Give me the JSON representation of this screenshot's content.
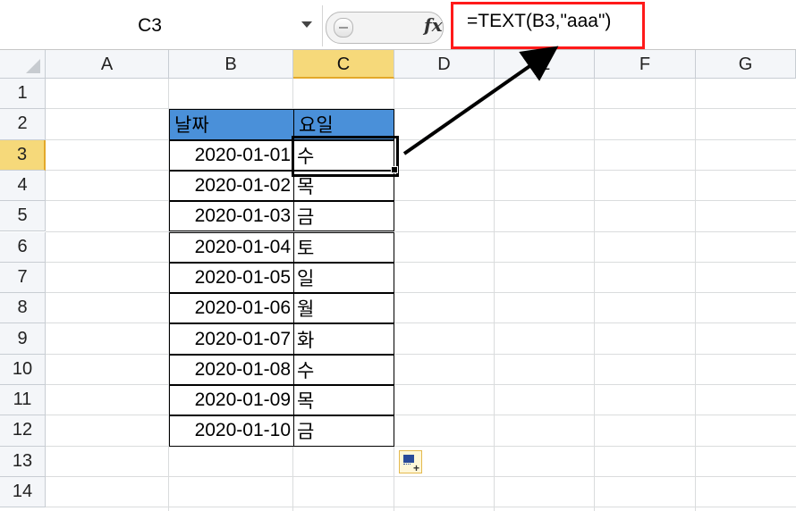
{
  "formula_bar": {
    "name_box": "C3",
    "fx_label": "fx",
    "formula": "=TEXT(B3,\"aaa\")"
  },
  "columns": [
    "A",
    "B",
    "C",
    "D",
    "E",
    "F",
    "G"
  ],
  "rows": [
    "1",
    "2",
    "3",
    "4",
    "5",
    "6",
    "7",
    "8",
    "9",
    "10",
    "11",
    "12",
    "13",
    "14"
  ],
  "selected": {
    "column": "C",
    "row": "3"
  },
  "table": {
    "headers": [
      "날짜",
      "요일"
    ],
    "data": [
      [
        "2020-01-01",
        "수"
      ],
      [
        "2020-01-02",
        "목"
      ],
      [
        "2020-01-03",
        "금"
      ],
      [
        "2020-01-04",
        "토"
      ],
      [
        "2020-01-05",
        "일"
      ],
      [
        "2020-01-06",
        "월"
      ],
      [
        "2020-01-07",
        "화"
      ],
      [
        "2020-01-08",
        "수"
      ],
      [
        "2020-01-09",
        "목"
      ],
      [
        "2020-01-10",
        "금"
      ]
    ]
  },
  "colors": {
    "header_fill": "#4a90d9",
    "highlight_box": "#ff1a1a",
    "selection": "#f6d97a"
  },
  "icons": {
    "quick_analysis": "quick-analysis-icon",
    "name_box_dropdown": "chevron-down-icon",
    "annotation_arrow": "arrow-icon"
  }
}
